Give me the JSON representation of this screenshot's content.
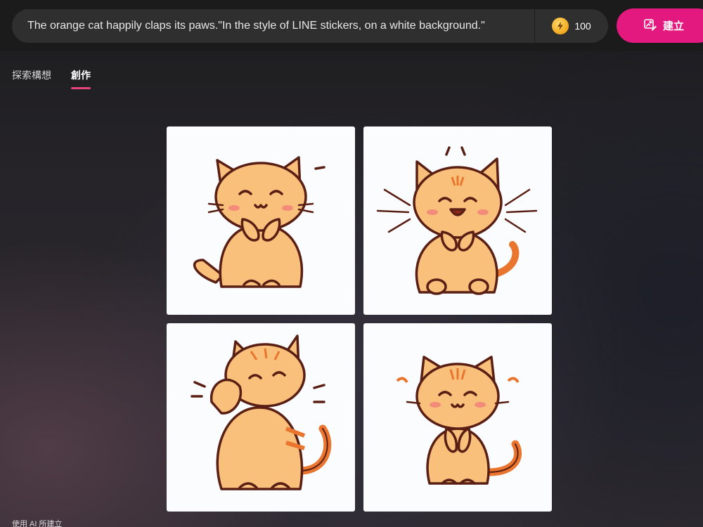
{
  "prompt": {
    "text": "The orange cat happily claps its paws.\"In the style of LINE stickers, on a white background.\""
  },
  "credits": {
    "count": "100",
    "icon": "lightning-coin-icon"
  },
  "create_button": {
    "label": "建立",
    "icon": "image-edit-icon",
    "color": "#e3197f"
  },
  "tabs": [
    {
      "label": "探索構想",
      "active": false
    },
    {
      "label": "創作",
      "active": true
    }
  ],
  "images": [
    {
      "subject": "orange-cat-clapping-sticker"
    },
    {
      "subject": "orange-cat-clapping-sticker"
    },
    {
      "subject": "orange-cat-clapping-sticker"
    },
    {
      "subject": "orange-cat-clapping-sticker"
    }
  ],
  "footer": {
    "note": "使用 AI 所建立"
  },
  "colors": {
    "accent": "#e3197f",
    "tab_underline": "#e8457a",
    "cat_fill": "#f8c07a",
    "cat_outline": "#5a1f14"
  }
}
